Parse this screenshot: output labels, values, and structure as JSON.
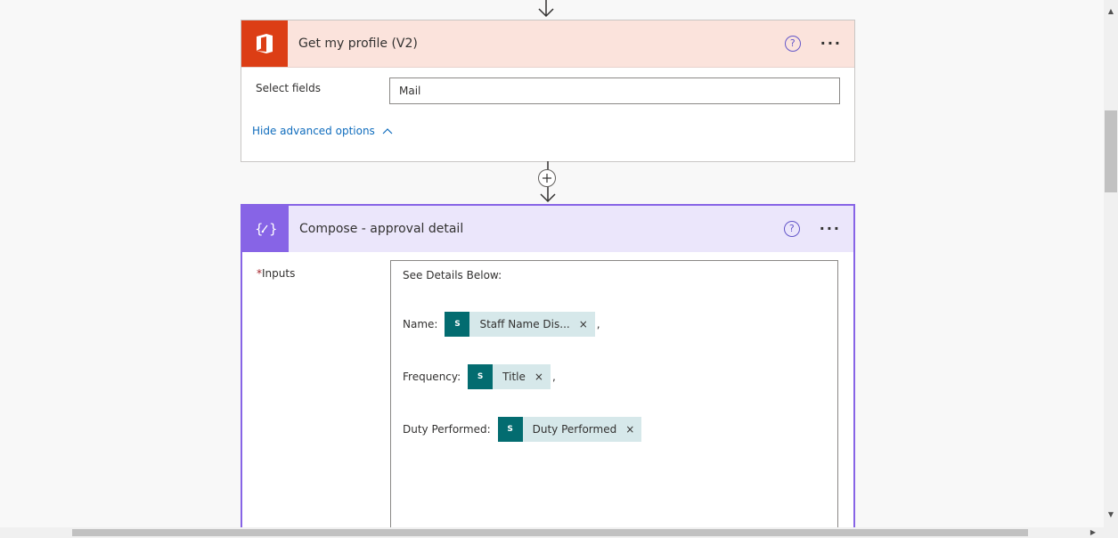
{
  "profile_card": {
    "title": "Get my profile (V2)",
    "help_symbol": "?",
    "more_symbol": "···",
    "field_label": "Select fields",
    "field_value": "Mail",
    "toggle_label": "Hide advanced options",
    "icon": "office-icon",
    "accent_color": "#dc3e15"
  },
  "compose_card": {
    "title": "Compose - approval detail",
    "help_symbol": "?",
    "more_symbol": "···",
    "required_mark": "*",
    "field_label": "Inputs",
    "icon": "compose-icon",
    "accent_color": "#8764e6",
    "content": {
      "intro": "See Details Below:",
      "lines": [
        {
          "label": "Name:",
          "token": "Staff Name Dis...",
          "suffix": ","
        },
        {
          "label": "Frequency:",
          "token": "Title",
          "suffix": ","
        },
        {
          "label": "Duty Performed:",
          "token": "Duty Performed",
          "suffix": ""
        }
      ],
      "token_icon_text": "S",
      "token_remove": "×"
    }
  },
  "connector": {
    "add_symbol": "+"
  }
}
